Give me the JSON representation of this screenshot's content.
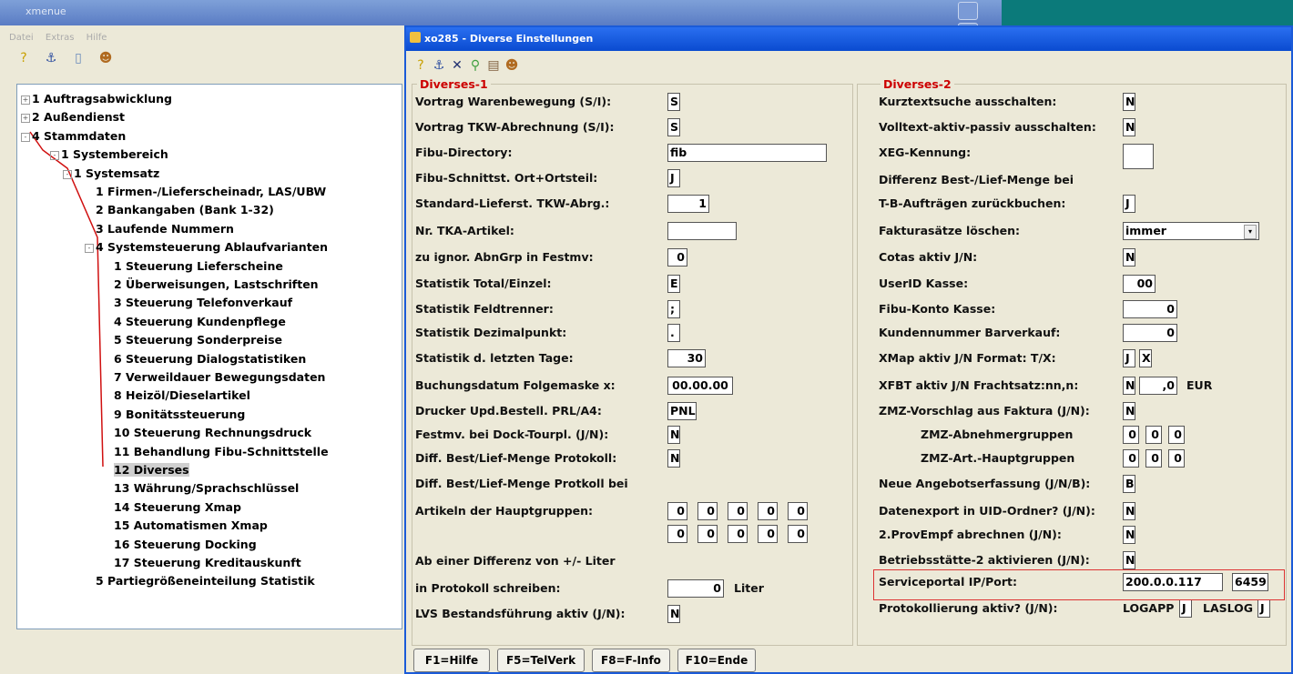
{
  "bg_window": {
    "title": "xmenue",
    "menu": [
      "Datei",
      "Extras",
      "Hilfe"
    ]
  },
  "tree": {
    "items": [
      {
        "label": "1 Auftragsabwicklung",
        "toggle": "+"
      },
      {
        "label": "2 Außendienst",
        "toggle": "+"
      },
      {
        "label": "4 Stammdaten",
        "toggle": "-"
      },
      {
        "label": "1 Systembereich",
        "toggle": "-"
      },
      {
        "label": "1 Systemsatz",
        "toggle": "-"
      },
      {
        "label": "1 Firmen-/Lieferscheinadr, LAS/UBW"
      },
      {
        "label": "2 Bankangaben (Bank 1-32)"
      },
      {
        "label": "3 Laufende Nummern"
      },
      {
        "label": "4 Systemsteuerung Ablaufvarianten",
        "toggle": "-"
      },
      {
        "label": "1 Steuerung Lieferscheine"
      },
      {
        "label": "2 Überweisungen, Lastschriften"
      },
      {
        "label": "3 Steuerung Telefonverkauf"
      },
      {
        "label": "4 Steuerung Kundenpflege"
      },
      {
        "label": "5 Steuerung Sonderpreise"
      },
      {
        "label": "6 Steuerung Dialogstatistiken"
      },
      {
        "label": "7 Verweildauer Bewegungsdaten"
      },
      {
        "label": "8 Heizöl/Dieselartikel"
      },
      {
        "label": "9 Bonitätssteuerung"
      },
      {
        "label": "10 Steuerung Rechnungsdruck"
      },
      {
        "label": "11 Behandlung Fibu-Schnittstelle"
      },
      {
        "label": "12 Diverses",
        "selected": true
      },
      {
        "label": "13 Währung/Sprachschlüssel"
      },
      {
        "label": "14 Steuerung Xmap"
      },
      {
        "label": "15 Automatismen Xmap"
      },
      {
        "label": "16 Steuerung Docking"
      },
      {
        "label": "17 Steuerung Kreditauskunft"
      },
      {
        "label": "5 Partiegrößeneinteilung Statistik"
      }
    ]
  },
  "dialog": {
    "title": "xo285 - Diverse Einstellungen",
    "group1": {
      "title": "Diverses-1",
      "rows": [
        {
          "label": "Vortrag Warenbewegung  (S/I):",
          "value": "S"
        },
        {
          "label": "Vortrag TKW-Abrechnung (S/I):",
          "value": "S"
        },
        {
          "label": "Fibu-Directory:",
          "value": "fib"
        },
        {
          "label": "Fibu-Schnittst. Ort+Ortsteil:",
          "value": "J"
        },
        {
          "label": "Standard-Lieferst. TKW-Abrg.:",
          "value": "1"
        },
        {
          "label": "Nr. TKA-Artikel:",
          "value": ""
        },
        {
          "label": "zu ignor. AbnGrp in Festmv:",
          "value": "0"
        },
        {
          "label": "Statistik Total/Einzel:",
          "value": "E"
        },
        {
          "label": "Statistik Feldtrenner:",
          "value": ";"
        },
        {
          "label": "Statistik Dezimalpunkt:",
          "value": "."
        },
        {
          "label": "Statistik d. letzten Tage:",
          "value": "30"
        },
        {
          "label": "Buchungsdatum Folgemaske x:",
          "value": "00.00.00"
        },
        {
          "label": "Drucker Upd.Bestell. PRL/A4:",
          "value": "PNL"
        },
        {
          "label": "Festmv. bei Dock-Tourpl. (J/N):",
          "value": "N"
        },
        {
          "label": "Diff. Best/Lief-Menge Protokoll:",
          "value": "N"
        },
        {
          "label": "Diff. Best/Lief-Menge Protkoll bei"
        },
        {
          "label": "Artikeln der Hauptgruppen:",
          "grid1": [
            "0",
            "0",
            "0",
            "0",
            "0"
          ],
          "grid2": [
            "0",
            "0",
            "0",
            "0",
            "0"
          ]
        },
        {
          "label": "Ab einer Differenz von +/- Liter"
        },
        {
          "label": "in Protokoll schreiben:",
          "value": "0",
          "unit": "Liter"
        },
        {
          "label": "LVS Bestandsführung aktiv (J/N):",
          "value": "N"
        }
      ]
    },
    "group2": {
      "title": "Diverses-2",
      "rows": [
        {
          "label": "Kurztextsuche ausschalten:",
          "value": "N"
        },
        {
          "label": "Volltext-aktiv-passiv ausschalten:",
          "value": "N"
        },
        {
          "label": "XEG-Kennung:",
          "value": ""
        },
        {
          "label": "Differenz Best-/Lief-Menge bei"
        },
        {
          "label": "T-B-Aufträgen zurückbuchen:",
          "value": "J"
        },
        {
          "label": "Fakturasätze löschen:",
          "value": "immer"
        },
        {
          "label": "Cotas aktiv J/N:",
          "value": "N"
        },
        {
          "label": "UserID Kasse:",
          "value": "00"
        },
        {
          "label": "Fibu-Konto Kasse:",
          "value": "0"
        },
        {
          "label": "Kundennummer Barverkauf:",
          "value": "0"
        },
        {
          "label": "XMap aktiv J/N  Format: T/X:",
          "value": "J",
          "value2": "X"
        },
        {
          "label": "XFBT aktiv J/N  Frachtsatz:nn,n:",
          "value": "N",
          "value2": ",0",
          "unit": "EUR"
        },
        {
          "label": "ZMZ-Vorschlag aus Faktura (J/N):",
          "value": "N"
        },
        {
          "label": "ZMZ-Abnehmergruppen",
          "grid": [
            "0",
            "0",
            "0"
          ]
        },
        {
          "label": "ZMZ-Art.-Hauptgruppen",
          "grid": [
            "0",
            "0",
            "0"
          ]
        },
        {
          "label": "Neue Angebotserfassung (J/N/B):",
          "value": "B"
        },
        {
          "label": "Datenexport in UID-Ordner? (J/N):",
          "value": "N"
        },
        {
          "label": "2.ProvEmpf abrechnen (J/N):",
          "value": "N"
        },
        {
          "label": "Betriebsstätte-2 aktivieren (J/N):",
          "value": "N"
        },
        {
          "label": "Serviceportal IP/Port:",
          "value": "200.0.0.117",
          "value2": "6459"
        },
        {
          "label": "Protokollierung aktiv? (J/N):",
          "logapp_label": "LOGAPP",
          "logapp": "J",
          "laslog_label": "LASLOG",
          "laslog": "J"
        }
      ]
    },
    "buttons": [
      "F1=Hilfe",
      "F5=TelVerk",
      "F8=F-Info",
      "F10=Ende"
    ]
  },
  "colors": {
    "accent": "#1b5bd8",
    "group_title": "#cc0000",
    "highlight_box": "#dd3333"
  }
}
